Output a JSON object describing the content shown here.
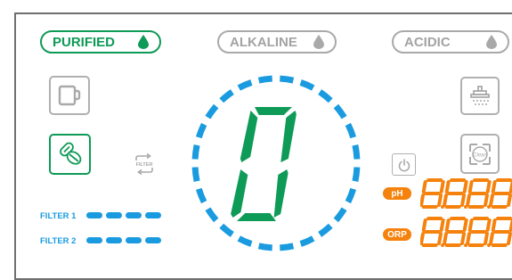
{
  "modes": [
    {
      "label": "PURIFIED",
      "active": true
    },
    {
      "label": "ALKALINE",
      "active": false
    },
    {
      "label": "ACIDIC",
      "active": false
    }
  ],
  "left_icons": [
    {
      "name": "cup-icon"
    },
    {
      "name": "filter-capsules-icon"
    },
    {
      "name": "filter-cycle-icon",
      "text": "FILTER"
    }
  ],
  "right_icons": [
    {
      "name": "shower-icon"
    },
    {
      "name": "clean-icon",
      "text": "Clean"
    },
    {
      "name": "power-icon"
    }
  ],
  "filters": [
    {
      "label": "FILTER 1",
      "level": 4
    },
    {
      "label": "FILTER 2",
      "level": 4
    }
  ],
  "center_display": {
    "digit": "0",
    "ring_segments": 24
  },
  "readouts": [
    {
      "badge": "pH",
      "value": "8.8.8.8"
    },
    {
      "badge": "ORP",
      "value": "8.8.8.8"
    }
  ],
  "colors": {
    "green": "#0e9a57",
    "blue": "#1a9be0",
    "orange": "#f5820d",
    "gray": "#a9a9a9"
  }
}
